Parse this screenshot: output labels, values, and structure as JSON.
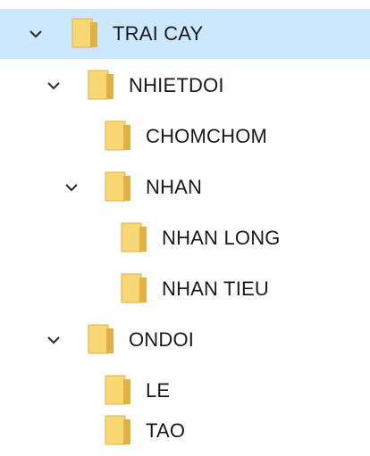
{
  "tree": {
    "items": [
      {
        "label": "TRAI CAY"
      },
      {
        "label": "NHIETDOI"
      },
      {
        "label": "CHOMCHOM"
      },
      {
        "label": "NHAN"
      },
      {
        "label": "NHAN LONG"
      },
      {
        "label": "NHAN TIEU"
      },
      {
        "label": "ONDOI"
      },
      {
        "label": "LE"
      },
      {
        "label": "TAO"
      }
    ]
  },
  "colors": {
    "selection": "#cce8ff",
    "folder_light": "#f8d775",
    "folder_dark": "#e1b243"
  }
}
